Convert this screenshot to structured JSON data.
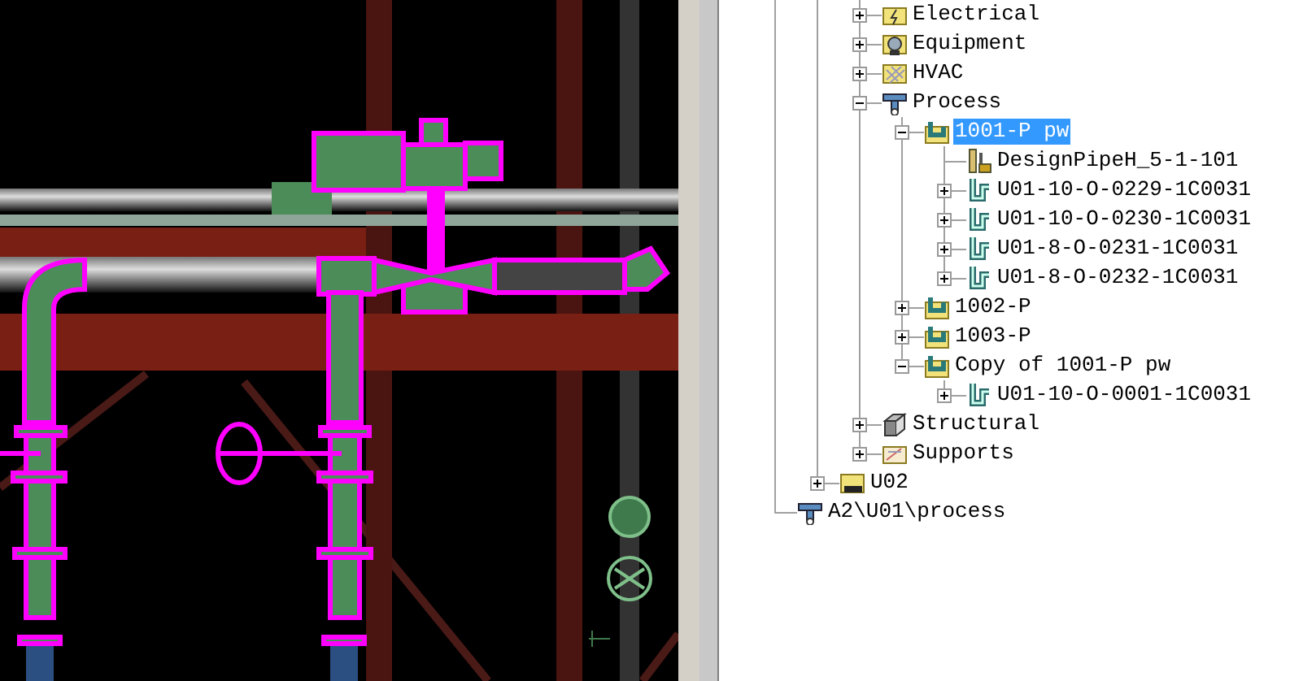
{
  "tree": {
    "branches": [
      {
        "label": "Electrical",
        "kind": "electrical",
        "expanded": false,
        "selected": false
      },
      {
        "label": "Equipment",
        "kind": "equipment",
        "expanded": false,
        "selected": false
      },
      {
        "label": "HVAC",
        "kind": "hvac",
        "expanded": false,
        "selected": false
      },
      {
        "label": "Process",
        "kind": "process",
        "expanded": true,
        "selected": false,
        "children": [
          {
            "label": "1001-P pw",
            "kind": "pipeline",
            "expanded": true,
            "selected": true,
            "children": [
              {
                "label": "DesignPipeH_5-1-101",
                "kind": "design",
                "selected": false
              },
              {
                "label": "U01-10-O-0229-1C0031",
                "kind": "pipe",
                "expanded": false,
                "selected": false
              },
              {
                "label": "U01-10-O-0230-1C0031",
                "kind": "pipe",
                "expanded": false,
                "selected": false
              },
              {
                "label": "U01-8-O-0231-1C0031",
                "kind": "pipe",
                "expanded": false,
                "selected": false
              },
              {
                "label": "U01-8-O-0232-1C0031",
                "kind": "pipe",
                "expanded": false,
                "selected": false
              }
            ]
          },
          {
            "label": "1002-P",
            "kind": "pipeline",
            "expanded": false,
            "selected": false
          },
          {
            "label": "1003-P",
            "kind": "pipeline",
            "expanded": false,
            "selected": false
          },
          {
            "label": "Copy of 1001-P pw",
            "kind": "pipeline",
            "expanded": true,
            "selected": false,
            "children": [
              {
                "label": "U01-10-O-0001-1C0031",
                "kind": "pipe",
                "expanded": false,
                "selected": false
              }
            ]
          }
        ]
      },
      {
        "label": "Structural",
        "kind": "structural",
        "expanded": false,
        "selected": false
      },
      {
        "label": "Supports",
        "kind": "supports",
        "expanded": false,
        "selected": false
      }
    ],
    "outer_items": [
      {
        "label": "U02",
        "kind": "unit",
        "expanded": false,
        "selected": false
      }
    ],
    "root_items": [
      {
        "label": "A2\\U01\\process",
        "kind": "system",
        "selected": false
      }
    ]
  }
}
